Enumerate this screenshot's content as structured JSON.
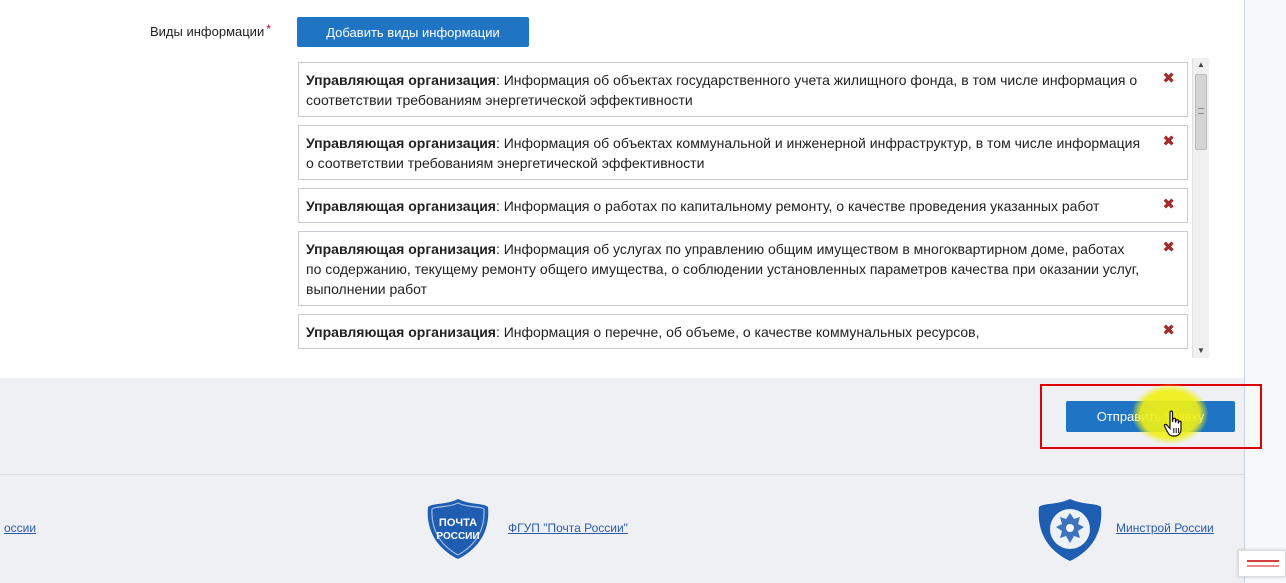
{
  "form": {
    "label": "Виды информации",
    "required_mark": "*",
    "add_button": "Добавить виды информации",
    "items": [
      {
        "org": "Управляющая организация",
        "text": ": Информация об объектах государственного учета жилищного фонда, в том числе информация о соответствии требованиям энергетической эффективности"
      },
      {
        "org": "Управляющая организация",
        "text": ": Информация об объектах коммунальной и инженерной инфраструктур, в том числе информация о соответствии требованиям энергетической эффективности"
      },
      {
        "org": "Управляющая организация",
        "text": ": Информация о работах по капитальному ремонту, о качестве проведения указанных работ"
      },
      {
        "org": "Управляющая организация",
        "text": ": Информация об услугах по управлению общим имуществом в многоквартирном доме, работах по содержанию, текущему ремонту общего имущества, о соблюдении установленных параметров качества при оказании услуг, выполнении работ"
      },
      {
        "org": "Управляющая организация",
        "text": ": Информация о перечне, об объеме, о качестве коммунальных ресурсов,"
      }
    ],
    "delete_glyph": "✖",
    "submit_button": "Отправить заявку"
  },
  "footer": {
    "left_link": "оссии",
    "post_logo_line1": "ПОЧТА",
    "post_logo_line2": "РОССИИ",
    "post_link": "ФГУП \"Почта России\"",
    "minstroy_link": "Минстрой России"
  },
  "colors": {
    "primary": "#1f74c3",
    "highlight": "#e00000",
    "delete": "#a32a2a"
  },
  "icons": {
    "delete": "close-icon",
    "scroll_up": "arrow-up-icon",
    "scroll_down": "arrow-down-icon",
    "cursor": "hand-cursor-icon"
  }
}
